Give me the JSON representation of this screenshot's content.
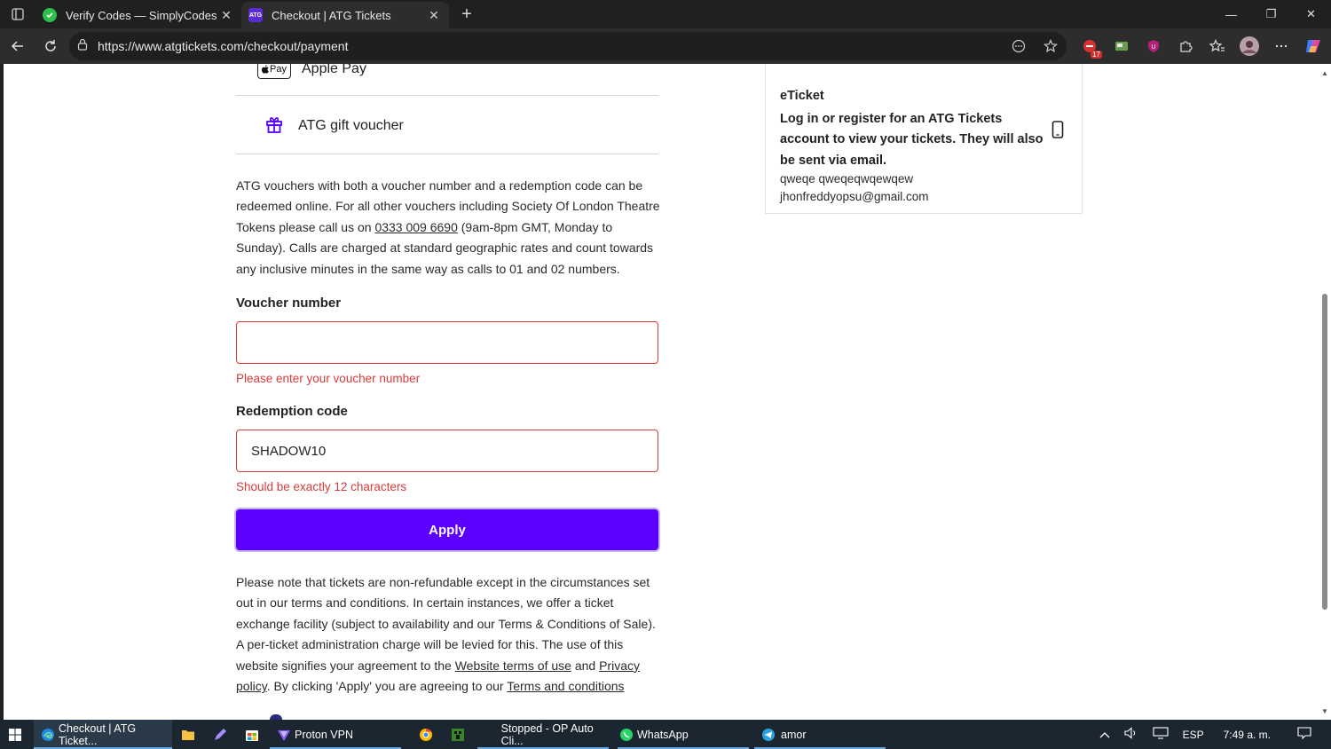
{
  "browser": {
    "tabs": [
      {
        "title": "Verify Codes — SimplyCodes",
        "favicon": "simplycodes-icon",
        "active": false
      },
      {
        "title": "Checkout | ATG Tickets",
        "favicon": "atg-icon",
        "favicon_text": "ATG",
        "active": true
      }
    ],
    "url": "https://www.atgtickets.com/checkout/payment",
    "extension_badge": "17"
  },
  "payment": {
    "apple_logo_text": "Pay",
    "apple_pay_label": "Apple Pay",
    "gift_voucher_label": "ATG gift voucher",
    "info": {
      "part1": "ATG vouchers with both a voucher number and a redemption code can be redeemed online. For all other vouchers including Society Of London Theatre Tokens please call us on ",
      "phone": "0333 009 6690",
      "part2": " (9am-8pm GMT, Monday to Sunday). Calls are charged at standard geographic rates and count towards any inclusive minutes in the same way as calls to 01 and 02 numbers."
    },
    "voucher": {
      "label": "Voucher number",
      "value": "",
      "error": "Please enter your voucher number"
    },
    "redemption": {
      "label": "Redemption code",
      "value": "SHADOW10",
      "error": "Should be exactly 12 characters"
    },
    "apply_label": "Apply",
    "terms": {
      "part1": "Please note that tickets are non-refundable except in the circumstances set out in our terms and conditions. In certain instances, we offer a ticket exchange facility (subject to availability and our Terms & Conditions of Sale). A per-ticket administration charge will be levied for this. The use of this website signifies your agreement to the ",
      "link1": "Website terms of use",
      "and": " and ",
      "link2": "Privacy policy",
      "part2": ". By clicking 'Apply' you are agreeing to our ",
      "link3": "Terms and conditions"
    }
  },
  "eticket": {
    "title": "eTicket",
    "message": "Log in or register for an ATG Tickets account to view your tickets. They will also be sent via email.",
    "name": "qweqe qweqeqwqewqew",
    "email": "jhonfreddyopsu@gmail.com"
  },
  "taskbar": {
    "items": [
      {
        "label": "Checkout | ATG Ticket...",
        "icon": "edge-icon"
      },
      {
        "label": "Proton VPN",
        "icon": "protonvpn-icon"
      },
      {
        "label": "Stopped - OP Auto Cli...",
        "icon": "autoclicker-icon"
      },
      {
        "label": "WhatsApp",
        "icon": "whatsapp-icon"
      },
      {
        "label": "amor",
        "icon": "telegram-icon"
      }
    ],
    "language": "ESP",
    "time": "7:49 a. m."
  },
  "colors": {
    "accent": "#5b00ff",
    "error": "#d63b3b"
  }
}
